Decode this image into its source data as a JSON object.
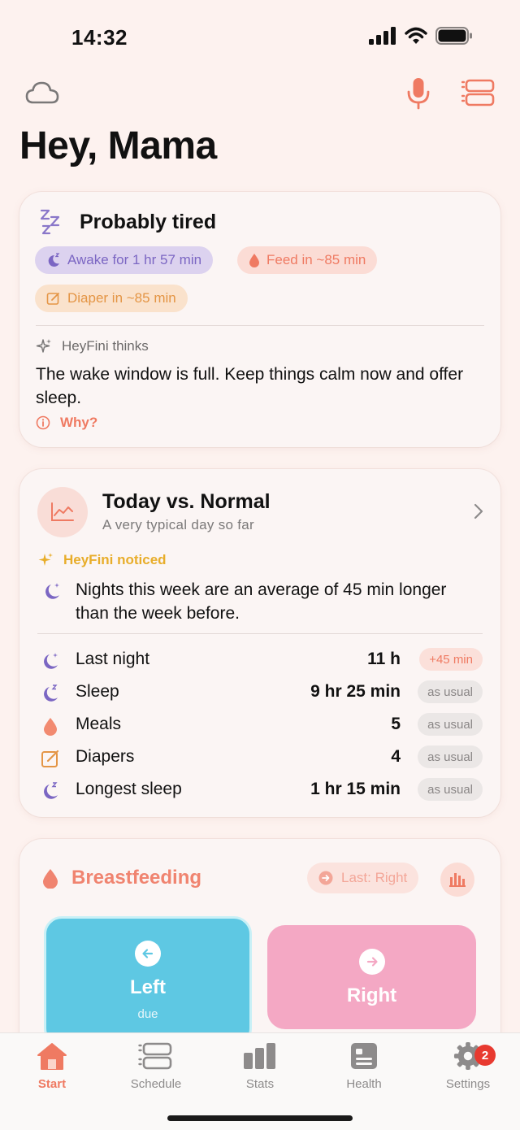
{
  "status_bar": {
    "time": "14:32"
  },
  "greeting": "Hey, Mama",
  "tired_card": {
    "title": "Probably tired",
    "chips": {
      "awake": "Awake for 1 hr 57 min",
      "feed": "Feed in ~85 min",
      "diaper": "Diaper in ~85 min"
    },
    "thinks_label": "HeyFini thinks",
    "thinks_text": "The wake window is full. Keep things calm now and offer sleep.",
    "why_label": "Why?"
  },
  "today_card": {
    "title": "Today vs. Normal",
    "subtitle": "A very typical day so far",
    "noticed_label": "HeyFini noticed",
    "noticed_text": "Nights this week are an average of 45 min longer than the week before.",
    "stats": [
      {
        "label": "Last night",
        "value": "11 h",
        "badge": "+45 min",
        "icon": "moon-stars-icon"
      },
      {
        "label": "Sleep",
        "value": "9 hr 25 min",
        "badge": "as usual",
        "icon": "moon-zz-icon"
      },
      {
        "label": "Meals",
        "value": "5",
        "badge": "as usual",
        "icon": "drop-icon"
      },
      {
        "label": "Diapers",
        "value": "4",
        "badge": "as usual",
        "icon": "diaper-note-icon"
      },
      {
        "label": "Longest sleep",
        "value": "1 hr 15 min",
        "badge": "as usual",
        "icon": "moon-zz-icon"
      }
    ]
  },
  "breast_card": {
    "title": "Breastfeeding",
    "last_label": "Last: Right",
    "left": {
      "label": "Left",
      "sub": "due"
    },
    "right": {
      "label": "Right"
    }
  },
  "tabs": [
    {
      "label": "Start",
      "icon": "home-icon"
    },
    {
      "label": "Schedule",
      "icon": "schedule-icon"
    },
    {
      "label": "Stats",
      "icon": "bar-chart-icon"
    },
    {
      "label": "Health",
      "icon": "health-icon"
    },
    {
      "label": "Settings",
      "icon": "gear-icon"
    }
  ],
  "settings_badge": "2",
  "colors": {
    "accent": "#ef7a62",
    "purple": "#7b66c3",
    "orange": "#e49545",
    "yellow": "#e8ad2a",
    "left_button": "#5ec8e3",
    "right_button": "#f4a8c4",
    "background": "#fdf2ef"
  }
}
